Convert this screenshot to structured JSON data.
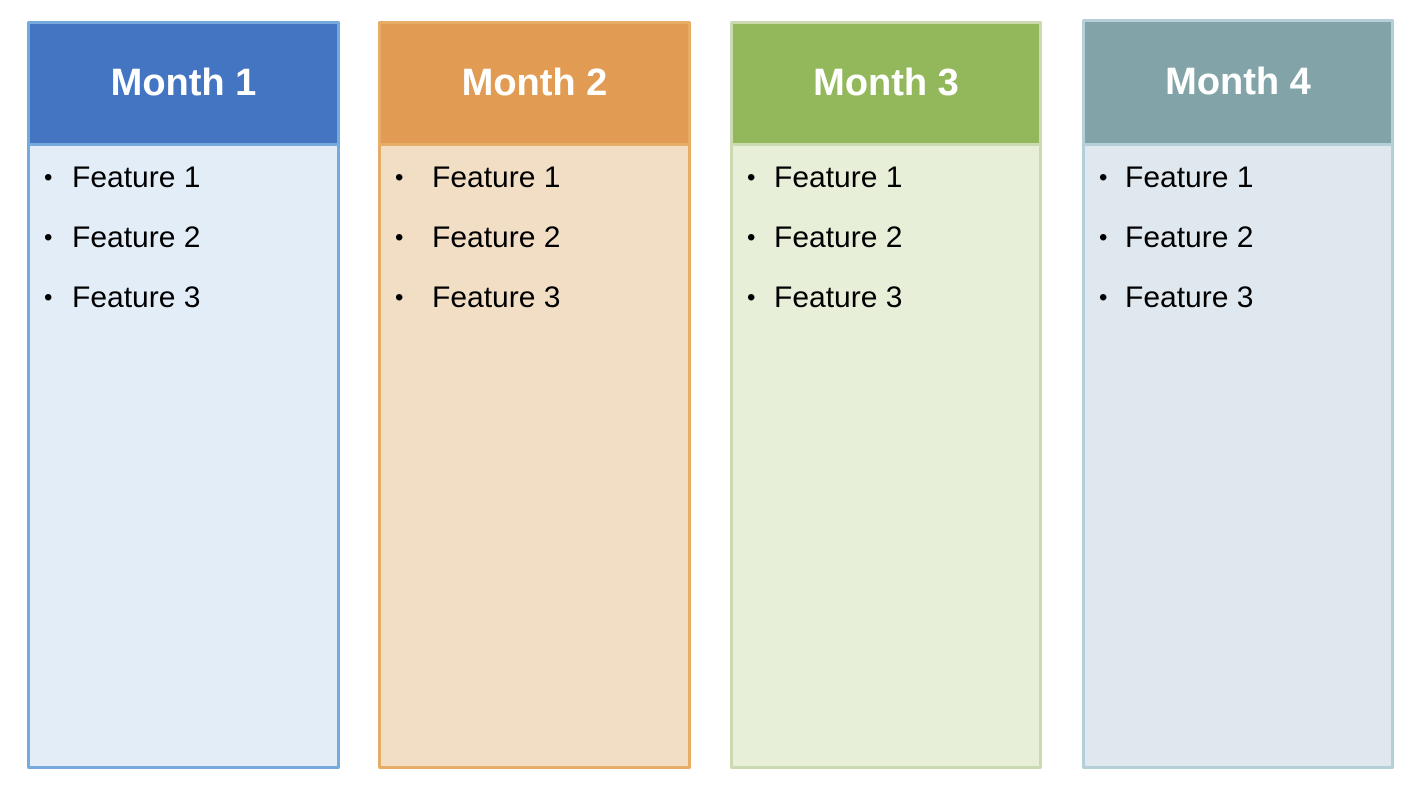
{
  "columns": [
    {
      "title": "Month 1",
      "header_color": "#4375c3",
      "body_color": "#e2edf8",
      "border_color": "#77a9dc",
      "items": [
        "Feature 1",
        "Feature 2",
        "Feature 3"
      ]
    },
    {
      "title": "Month 2",
      "header_color": "#e19b52",
      "body_color": "#f1dec4",
      "border_color": "#e6ad67",
      "items": [
        "Feature 1",
        "Feature 2",
        "Feature 3"
      ]
    },
    {
      "title": "Month 3",
      "header_color": "#93b75b",
      "body_color": "#e7efd9",
      "border_color": "#cbdab0",
      "items": [
        "Feature 1",
        "Feature 2",
        "Feature 3"
      ]
    },
    {
      "title": "Month 4",
      "header_color": "#82a4a8",
      "body_color": "#e0e8ef",
      "border_color": "#b5cfd9",
      "items": [
        "Feature 1",
        "Feature 2",
        "Feature 3"
      ]
    }
  ],
  "bullet_glyph": "•"
}
